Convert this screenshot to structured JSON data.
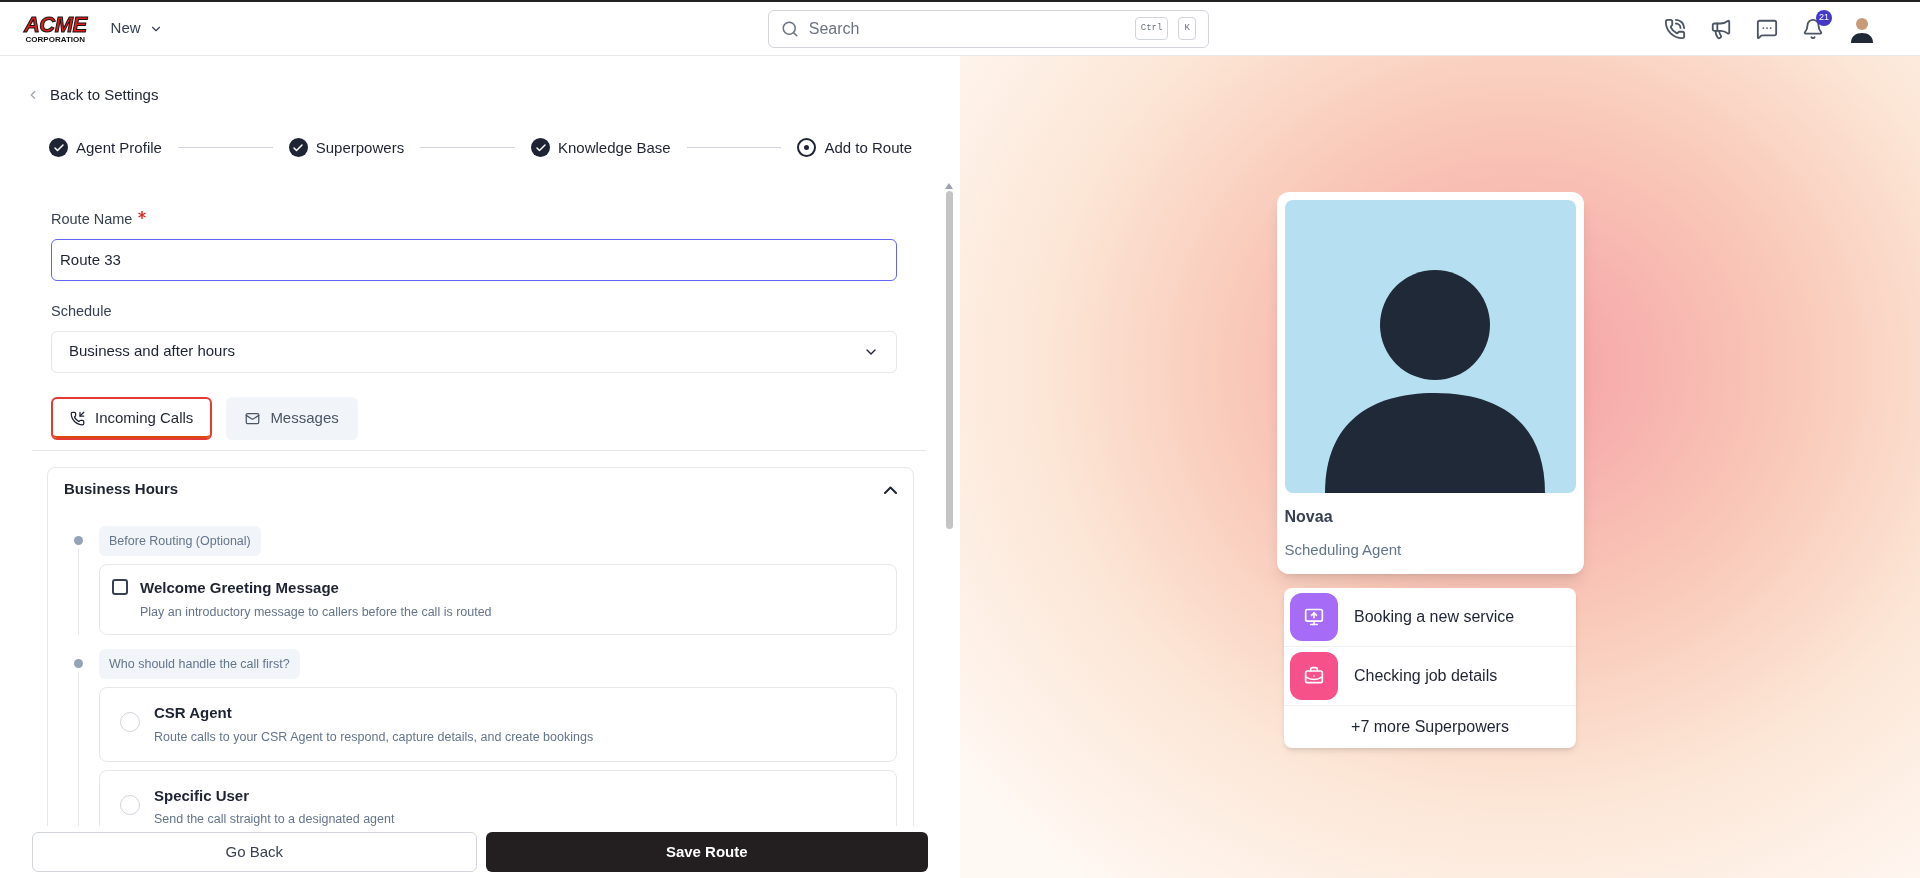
{
  "header": {
    "logo": {
      "title": "ACME",
      "subtitle": "CORPORATION"
    },
    "new_menu": "New",
    "search": {
      "placeholder": "Search",
      "shortcut": [
        "Ctrl",
        "K"
      ]
    },
    "notifications_count": "21"
  },
  "back_link": "Back to Settings",
  "steps": [
    {
      "label": "Agent Profile",
      "completed": true
    },
    {
      "label": "Superpowers",
      "completed": true
    },
    {
      "label": "Knowledge Base",
      "completed": true
    },
    {
      "label": "Add to Route",
      "completed": false
    }
  ],
  "form": {
    "route_name": {
      "label": "Route Name",
      "required": true,
      "value": "Route 33"
    },
    "schedule": {
      "label": "Schedule",
      "value": "Business and after hours"
    }
  },
  "tabs": [
    {
      "label": "Incoming Calls",
      "selected": true,
      "highlighted": true,
      "hovered": false
    },
    {
      "label": "Messages",
      "selected": false,
      "highlighted": false,
      "hovered": true
    }
  ],
  "section": {
    "title": "Business Hours",
    "expanded": true,
    "groups": [
      {
        "label": "Before Routing (Optional)",
        "options": [
          {
            "kind": "checkbox",
            "title": "Welcome Greeting Message",
            "description": "Play an introductory message to callers before the call is routed",
            "checked": false
          }
        ]
      },
      {
        "label": "Who should handle the call first?",
        "options": [
          {
            "kind": "radio",
            "title": "CSR Agent",
            "description": "Route calls to your CSR Agent to respond, capture details, and create bookings",
            "selected": false
          },
          {
            "kind": "radio",
            "title": "Specific User",
            "description": "Send the call straight to a designated agent",
            "selected": false
          }
        ]
      }
    ]
  },
  "actions": [
    {
      "label": "Go Back",
      "kind": "secondary"
    },
    {
      "label": "Save Route",
      "kind": "primary"
    }
  ],
  "agent_card": {
    "name": "Novaa",
    "role": "Scheduling Agent",
    "superpowers": [
      {
        "label": "Booking a new service",
        "color": "#a66cf7"
      },
      {
        "label": "Checking job details",
        "color": "#f7518a"
      }
    ],
    "more": "+7 more Superpowers"
  }
}
